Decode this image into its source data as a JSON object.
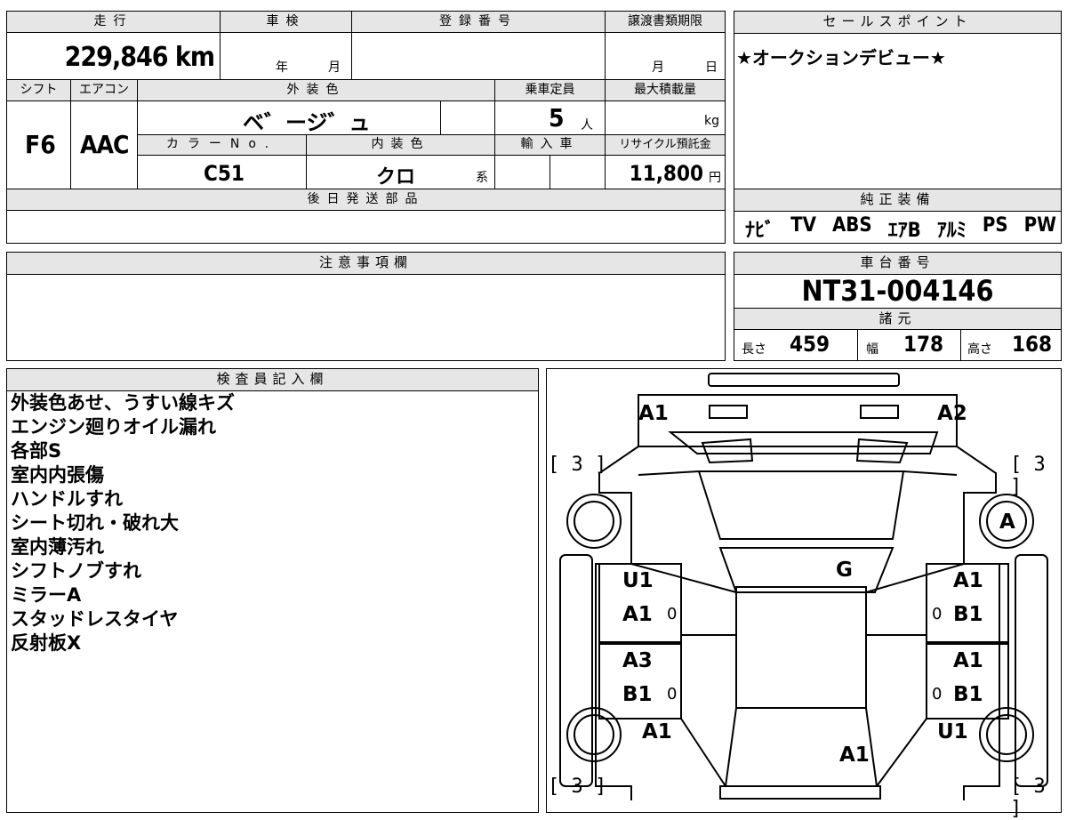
{
  "top": {
    "mileage_label": "走行",
    "mileage_value": "229,846 km",
    "shaken_label": "車検",
    "shaken_year": "年",
    "shaken_month": "月",
    "reg_label": "登録番号",
    "transfer_label": "譲渡書類期限",
    "transfer_month": "月",
    "transfer_day": "日",
    "shift_label": "シフト",
    "shift_value": "F6",
    "ac_label": "エアコン",
    "ac_value": "AAC",
    "exterior_label": "外装色",
    "exterior_value": "ベ゛ージ゛ュ",
    "capacity_label": "乗車定員",
    "capacity_value": "5",
    "capacity_unit": "人",
    "maxload_label": "最大積載量",
    "maxload_unit": "kg",
    "color_no_label": "カラーNo.",
    "color_no_value": "C51",
    "interior_label": "内装色",
    "interior_value": "クロ",
    "interior_unit": "系",
    "import_label": "輸入車",
    "recycle_label": "リサイクル預託金",
    "recycle_value": "11,800",
    "recycle_unit": "円",
    "later_parts_label": "後日発送部品"
  },
  "sales": {
    "label": "セールスポイント",
    "text": "★オークションデビュー★"
  },
  "equipment": {
    "label": "純正装備",
    "items": [
      "ﾅﾋﾞ",
      "TV",
      "ABS",
      "ｴｱB",
      "ｱﾙﾐ",
      "PS",
      "PW"
    ]
  },
  "caution": {
    "label": "注意事項欄"
  },
  "chassis": {
    "label": "車台番号",
    "value": "NT31-004146"
  },
  "specs": {
    "label": "諸元",
    "length_label": "長さ",
    "length_value": "459",
    "width_label": "幅",
    "width_value": "178",
    "height_label": "高さ",
    "height_value": "168"
  },
  "inspector": {
    "label": "検査員記入欄",
    "notes": [
      "外装色あせ、うすい線キズ",
      "エンジン廻りオイル漏れ",
      "各部S",
      "室内内張傷",
      "ハンドルすれ",
      "シート切れ・破れ大",
      "室内薄汚れ",
      "シフトノブすれ",
      "ミラーA",
      "スタッドレスタイヤ",
      "反射板X"
    ]
  },
  "diagram": {
    "front_left": "A1",
    "front_right": "A2",
    "tire_fl_bracket": "[ 3 ]",
    "tire_fr_bracket": "[ 3 ]",
    "tire_fr_mark": "A",
    "windshield_mark": "G",
    "door_fl_top": "U1",
    "door_fl_bottom": "A1",
    "door_fr_top": "A1",
    "door_fr_bottom": "B1",
    "door_rl_top": "A3",
    "door_rl_bottom": "B1",
    "door_rr_top": "A1",
    "door_rr_bottom": "B1",
    "rear_left": "A1",
    "rear_right": "U1",
    "rear_center": "A1",
    "tire_rl_bracket": "[ 3 ]",
    "tire_rr_bracket": "[ 3 ]",
    "zero_mark": "0"
  }
}
